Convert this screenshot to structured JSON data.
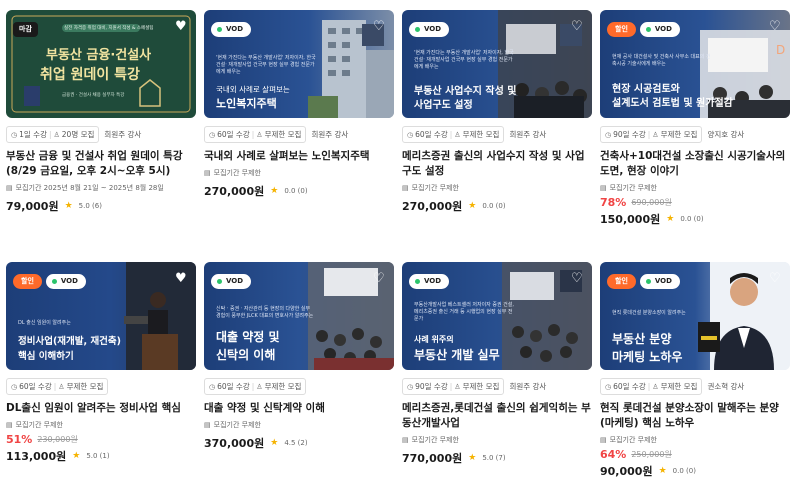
{
  "cards": [
    {
      "thumb": {
        "badges": [
          "마감"
        ],
        "line1": "부동산 금융·건설사",
        "line2": "취업 원데이 특강",
        "top_small": "실전 자격증 취업 대비, 지원서 작성 & 스페셜팁",
        "bottom_small": "금융권 ‧ 건설사 채용 실무자 특강"
      },
      "duration": "1일 수강",
      "capacity": "20명 모집",
      "teacher": "희원주 강사",
      "title": "부동산 금융 및 건설사 취업 원데이 특강 (8/29 금요일, 오후 2시~오후 5시)",
      "period": "모집기간 2025년 8월 21일 ~ 2025년 8월 28일",
      "price": "79,000원",
      "rating": "5.0 (6)"
    },
    {
      "thumb": {
        "badges": [
          "VOD"
        ],
        "line1": "국내외 사례로 살펴보는",
        "line2": "노인복지주택",
        "top_small": "'현재 가진다는 부동산 개발사업' 저자이자, 한국 건설‧ 재개발사업 건국부 현장 실무 경험 전문가에게 배우는"
      },
      "duration": "60일 수강",
      "capacity": "무제한 모집",
      "teacher": "희원주 강사",
      "title": "국내외 사례로 살펴보는 노인복지주택",
      "period": "모집기간 무제한",
      "price": "270,000원",
      "rating": "0.0 (0)"
    },
    {
      "thumb": {
        "badges": [
          "VOD"
        ],
        "line1": "부동산 사업수지 작성 및",
        "line2": "사업구도 설정",
        "top_small": "'현재 가진다는 부동산 개발사업' 저자이자, 한국 건설‧ 재개발사업 건국부 현장 실무 경험 전문가에게 배우는"
      },
      "duration": "60일 수강",
      "capacity": "무제한 모집",
      "teacher": "희원주 강사",
      "title": "메리츠증권 출신의 사업수지 작성 및 사업구도 설정",
      "period": "모집기간 무제한",
      "price": "270,000원",
      "rating": "0.0 (0)"
    },
    {
      "thumb": {
        "badges": [
          "할인",
          "VOD"
        ],
        "line1": "현장 시공검토와",
        "line2": "설계도서 검토법 및 원가절감",
        "top_small": "현재 공사 대건설사 및 건축사 사무소 대표의 건축시공 기술사에게 배우는"
      },
      "duration": "90일 수강",
      "capacity": "무제한 모집",
      "teacher": "양지호 강사",
      "title": "건축사+10대건설 소장출신 시공기술사의 도면, 현장 이야기",
      "period": "모집기간 무제한",
      "discount": "78%",
      "orig_price": "690,000원",
      "price": "150,000원",
      "rating": "0.0 (0)"
    },
    {
      "thumb": {
        "badges": [
          "할인",
          "VOD"
        ],
        "line1": "정비사업(재개발, 재건축)",
        "line2": "핵심 이해하기",
        "top_small": "DL 출신 임원이 알려주는"
      },
      "duration": "60일 수강",
      "capacity": "무제한 모집",
      "teacher": "",
      "title": "DL출신 임원이 알려주는 정비사업 핵심",
      "period": "모집기간 무제한",
      "discount": "51%",
      "orig_price": "230,000원",
      "price": "113,000원",
      "rating": "5.0 (1)"
    },
    {
      "thumb": {
        "badges": [
          "VOD"
        ],
        "line1": "대출 약정 및",
        "line2": "신탁의 이해",
        "top_small": "신탁 ‧ 증권 ‧ 자산관리 등 현장의 다양한 실무 경험이 풍부한 JLCK 대표의 변호사가 알려주는"
      },
      "duration": "60일 수강",
      "capacity": "무제한 모집",
      "teacher": "",
      "title": "대출 약정 및 신탁계약 이해",
      "period": "모집기간 무제한",
      "price": "370,000원",
      "rating": "4.5 (2)"
    },
    {
      "thumb": {
        "badges": [
          "VOD"
        ],
        "line1": "사례 위주의",
        "line2": "부동산 개발 실무",
        "top_small": "부동산개발사업 베스트셀러 저자이자 증권 건설, 메리츠증권 출신 거래 등 시행업의 현장 실무 전문가"
      },
      "duration": "90일 수강",
      "capacity": "무제한 모집",
      "teacher": "희원주 강사",
      "title": "메리츠증권,롯데건설 출신의 쉽게익히는 부동산개발사업",
      "period": "모집기간 무제한",
      "price": "770,000원",
      "rating": "5.0 (7)"
    },
    {
      "thumb": {
        "badges": [
          "할인",
          "VOD"
        ],
        "line1": "부동산 분양",
        "line2": "마케팅 노하우",
        "top_small": "현직 롯데건설 분양소장이 알려주는"
      },
      "duration": "60일 수강",
      "capacity": "무제한 모집",
      "teacher": "권소혁 강사",
      "title": "현직 롯데건설 분양소장이 말해주는 분양(마케팅) 핵심 노하우",
      "period": "모집기간 무제한",
      "discount": "64%",
      "orig_price": "250,000원",
      "price": "90,000원",
      "rating": "0.0 (0)"
    }
  ],
  "colors": {
    "accent_orange": "#ff6a2a",
    "discount_red": "#f04444",
    "star": "#f5b301",
    "vod_dot": "#2bc46b"
  }
}
